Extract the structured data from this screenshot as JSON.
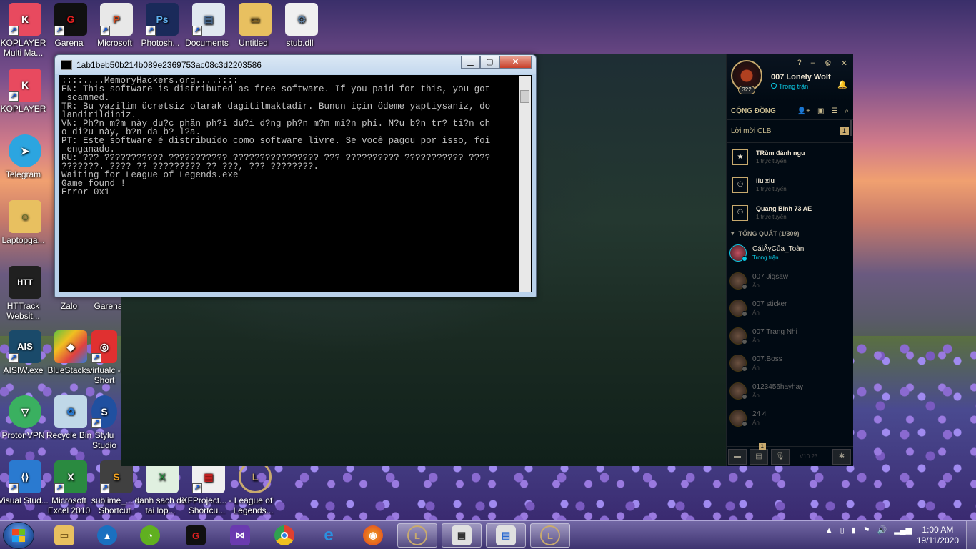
{
  "desktop_icons": [
    {
      "label": "KOPLAYER Multi Ma...",
      "icon": "koplayer-multi-icon",
      "color": "#e84a5f"
    },
    {
      "label": "KOPLAYER",
      "icon": "koplayer-icon",
      "color": "#e84a5f"
    },
    {
      "label": "Telegram",
      "icon": "telegram-icon",
      "color": "#2ca5e0"
    },
    {
      "label": "Laptopga...",
      "icon": "folder-user-icon",
      "color": "#e8c060"
    },
    {
      "label": "HTTrack Websit...",
      "icon": "httrack-icon",
      "color": "#202020"
    },
    {
      "label": "AISIW.exe",
      "icon": "aisiw-icon",
      "color": "#1a4a6a"
    },
    {
      "label": "ProtonVPN",
      "icon": "protonvpn-icon",
      "color": "#3ab060"
    },
    {
      "label": "Visual Stud...",
      "icon": "visual-studio-code-icon",
      "color": "#2a7ad0"
    },
    {
      "label": "Garena",
      "icon": "garena-icon",
      "color": "#101010"
    },
    {
      "label": "Microsoft",
      "icon": "powerpoint-icon",
      "color": "#e8e8e8"
    },
    {
      "label": "Photosh...",
      "icon": "photoshop-icon",
      "color": "#1a2a5a"
    },
    {
      "label": "Documents",
      "icon": "documents-icon",
      "color": "#e0e8f0"
    },
    {
      "label": "Untitled",
      "icon": "folder-icon",
      "color": "#e8c060"
    },
    {
      "label": "stub.dll",
      "icon": "dll-file-icon",
      "color": "#f0f0f0"
    },
    {
      "label": "Zalo",
      "icon": "zalo-icon",
      "color": "#2a6ad0"
    },
    {
      "label": "Garena",
      "icon": "garena-icon",
      "color": "#101010"
    },
    {
      "label": "BlueStacks",
      "icon": "bluestacks-icon",
      "color": "#60c040"
    },
    {
      "label": "virtualc - Short",
      "icon": "virtual-cd-icon",
      "color": "#e03030"
    },
    {
      "label": "Recycle Bin",
      "icon": "recycle-bin-icon",
      "color": "#c0d8e8"
    },
    {
      "label": "Stylu Studio",
      "icon": "stylus-studio-icon",
      "color": "#2050a0"
    },
    {
      "label": "Microsoft Excel 2010",
      "icon": "excel-icon",
      "color": "#2a8a40"
    },
    {
      "label": "sublime_... - Shortcut",
      "icon": "sublime-icon",
      "color": "#404040"
    },
    {
      "label": "danh sach de tai lop...",
      "icon": "excel-file-icon",
      "color": "#e0f0e0"
    },
    {
      "label": "XFProject... - Shortcu...",
      "icon": "xfproject-icon",
      "color": "#f0f0f0"
    },
    {
      "label": "League of Legends...",
      "icon": "league-of-legends-icon",
      "color": "#c8aa6e"
    }
  ],
  "console": {
    "title": "1ab1beb50b214b089e2369753ac08c3d2203586",
    "lines": [
      "::::....MemoryHackers.org....::::",
      "EN: This software is distributed as free-software. If you paid for this, you got",
      " scammed.",
      "TR: Bu yazilim ücretsiz olarak dagitilmaktadir. Bunun için ödeme yaptiysaniz, do",
      "landirildiniz.",
      "VN: Ph?n m?m này du?c phân ph?i du?i d?ng ph?n m?m mi?n phí. N?u b?n tr? ti?n ch",
      "o di?u này, b?n da b? l?a.",
      "PT: Este software é distribuído como software livre. Se você pagou por isso, foi",
      " enganado.",
      "RU: ??? ??????????? ??????????? ???????????????? ??? ?????????? ??????????? ????",
      "???????. ???? ?? ????????? ?? ???, ??? ????????.",
      "Waiting for League of Legends.exe",
      "Game found !",
      "Error 0x1"
    ]
  },
  "social": {
    "player_name": "007 Lonely Wolf",
    "player_status": "Trong trận",
    "level": "322",
    "section_title": "CỘNG ĐỒNG",
    "invites_label": "Lời mời CLB",
    "invites_count": "1",
    "clubs": [
      {
        "name": "TRùm đánh ngu",
        "status": "1 trực tuyến",
        "icon": "star-icon"
      },
      {
        "name": "liu xiu",
        "status": "1 trực tuyến",
        "icon": "group-icon"
      },
      {
        "name": "Quang Binh 73 AE",
        "status": "1 trực tuyến",
        "icon": "group-icon"
      }
    ],
    "general_label": "TỔNG QUÁT (1/309)",
    "friends": [
      {
        "name": "CáiẤyCủa_Toàn",
        "status": "Trong trận",
        "online": true
      },
      {
        "name": "007 Jigsaw",
        "status": "Ẩn",
        "online": false
      },
      {
        "name": "007 sticker",
        "status": "Ẩn",
        "online": false
      },
      {
        "name": "007 Trang Nhi",
        "status": "Ẩn",
        "online": false
      },
      {
        "name": "007.Boss",
        "status": "Ẩn",
        "online": false
      },
      {
        "name": "0123456hayhay",
        "status": "Ẩn",
        "online": false
      },
      {
        "name": "24 4",
        "status": "Ẩn",
        "online": false
      }
    ],
    "notif_count": "1",
    "version": "V10.23"
  },
  "taskbar": {
    "apps": [
      {
        "name": "file-explorer",
        "icon": "folder-icon",
        "color": "#e8c060"
      },
      {
        "name": "alpha-app",
        "icon": "alpha-icon",
        "color": "#1a70c0"
      },
      {
        "name": "green-app",
        "icon": "leaf-icon",
        "color": "#60b020"
      },
      {
        "name": "garena",
        "icon": "garena-icon",
        "color": "#101010"
      },
      {
        "name": "visual-studio",
        "icon": "visual-studio-icon",
        "color": "#6a3ab0"
      },
      {
        "name": "chrome",
        "icon": "chrome-icon",
        "color": "#e0b020"
      },
      {
        "name": "internet-explorer",
        "icon": "internet-explorer-icon",
        "color": "#2a90e0"
      },
      {
        "name": "firefox",
        "icon": "firefox-icon",
        "color": "#e06020"
      },
      {
        "name": "league-client",
        "icon": "league-of-legends-icon",
        "color": "#c8aa6e"
      },
      {
        "name": "console-window",
        "icon": "console-icon",
        "color": "#e0e0e0"
      },
      {
        "name": "screen-window",
        "icon": "window-icon",
        "color": "#e0e0e0"
      },
      {
        "name": "league-game",
        "icon": "league-of-legends-icon",
        "color": "#c8aa6e"
      }
    ],
    "time": "1:00 AM",
    "date": "19/11/2020"
  }
}
